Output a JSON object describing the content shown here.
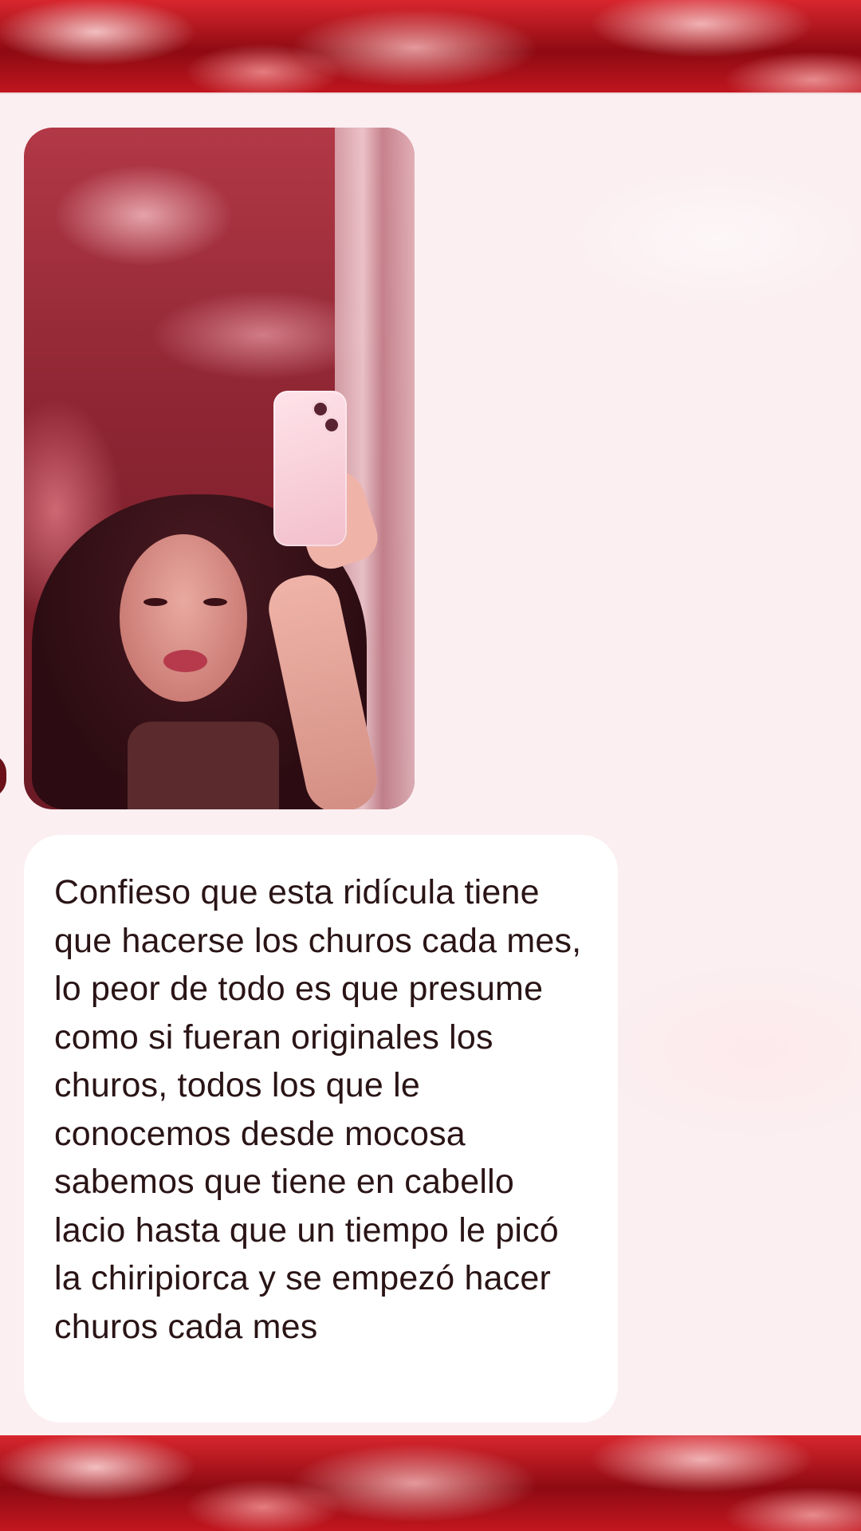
{
  "conversation": {
    "messages": [
      {
        "type": "image",
        "description_icon": "photo-icon"
      },
      {
        "type": "text",
        "text": "Confieso que esta ridícula tiene que hacerse los churos cada mes, lo peor de todo es que presume como si fueran originales los churos, todos los que le conocemos desde mocosa sabemos que tiene en cabello lacio hasta que un tiempo le picó la chiripiorca y se empezó hacer churos cada mes"
      }
    ]
  },
  "colors": {
    "background_accent": "#b01018",
    "panel": "#fbeff1",
    "bubble": "#ffffff",
    "text": "#2a1416"
  }
}
